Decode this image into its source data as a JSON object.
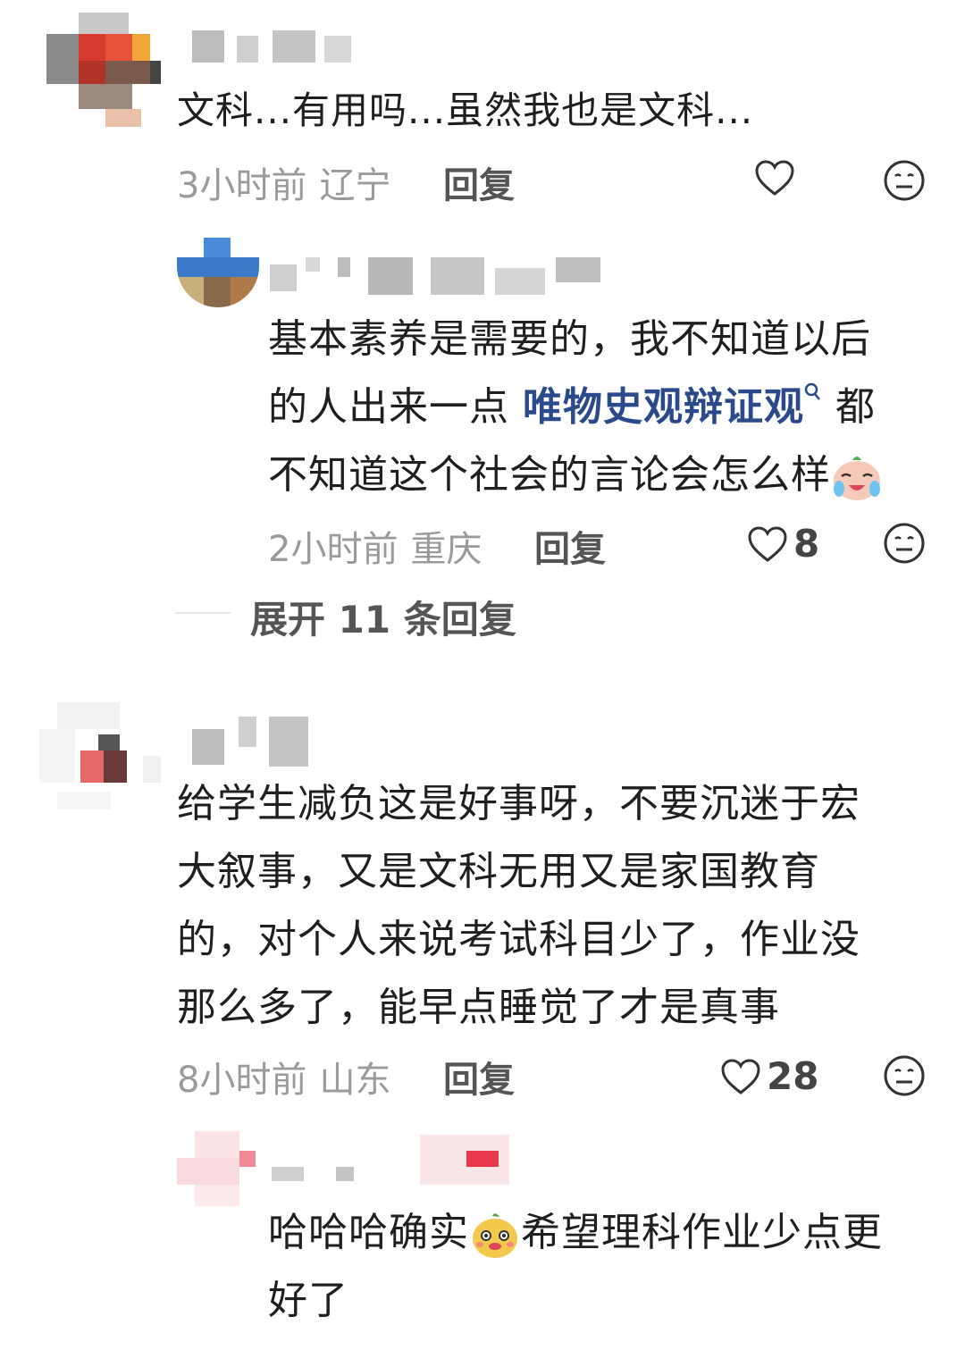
{
  "comments": [
    {
      "text": "文科...有用吗...虽然我也是文科...",
      "time": "3小时前",
      "location": "辽宁",
      "reply_label": "回复",
      "likes": "",
      "reply": {
        "text_1": "基本素养是需要的，我不知道以后",
        "text_2a": "的人出来一点 ",
        "topic": "唯物史观辩证观",
        "text_2b": " 都",
        "text_3": "不知道这个社会的言论会怎么样",
        "time": "2小时前",
        "location": "重庆",
        "reply_label": "回复",
        "likes": "8"
      },
      "expand_label": "展开 11 条回复"
    },
    {
      "line_1": "给学生减负这是好事呀，不要沉迷于宏",
      "line_2": "大叙事，又是文科无用又是家国教育",
      "line_3": "的，对个人来说考试科目少了，作业没",
      "line_4": "那么多了，能早点睡觉了才是真事",
      "time": "8小时前",
      "location": "山东",
      "reply_label": "回复",
      "likes": "28",
      "reply": {
        "text_1a": "哈哈哈确实",
        "text_1b": "希望理科作业少点更",
        "text_2": "好了"
      }
    }
  ],
  "icons": {
    "like": "heart-outline-icon",
    "dislike": "neutral-face-icon",
    "search": "search-icon"
  },
  "colors": {
    "text": "#1f1f1f",
    "meta": "#9a9a9a",
    "topic_link": "#2b4a8c"
  }
}
